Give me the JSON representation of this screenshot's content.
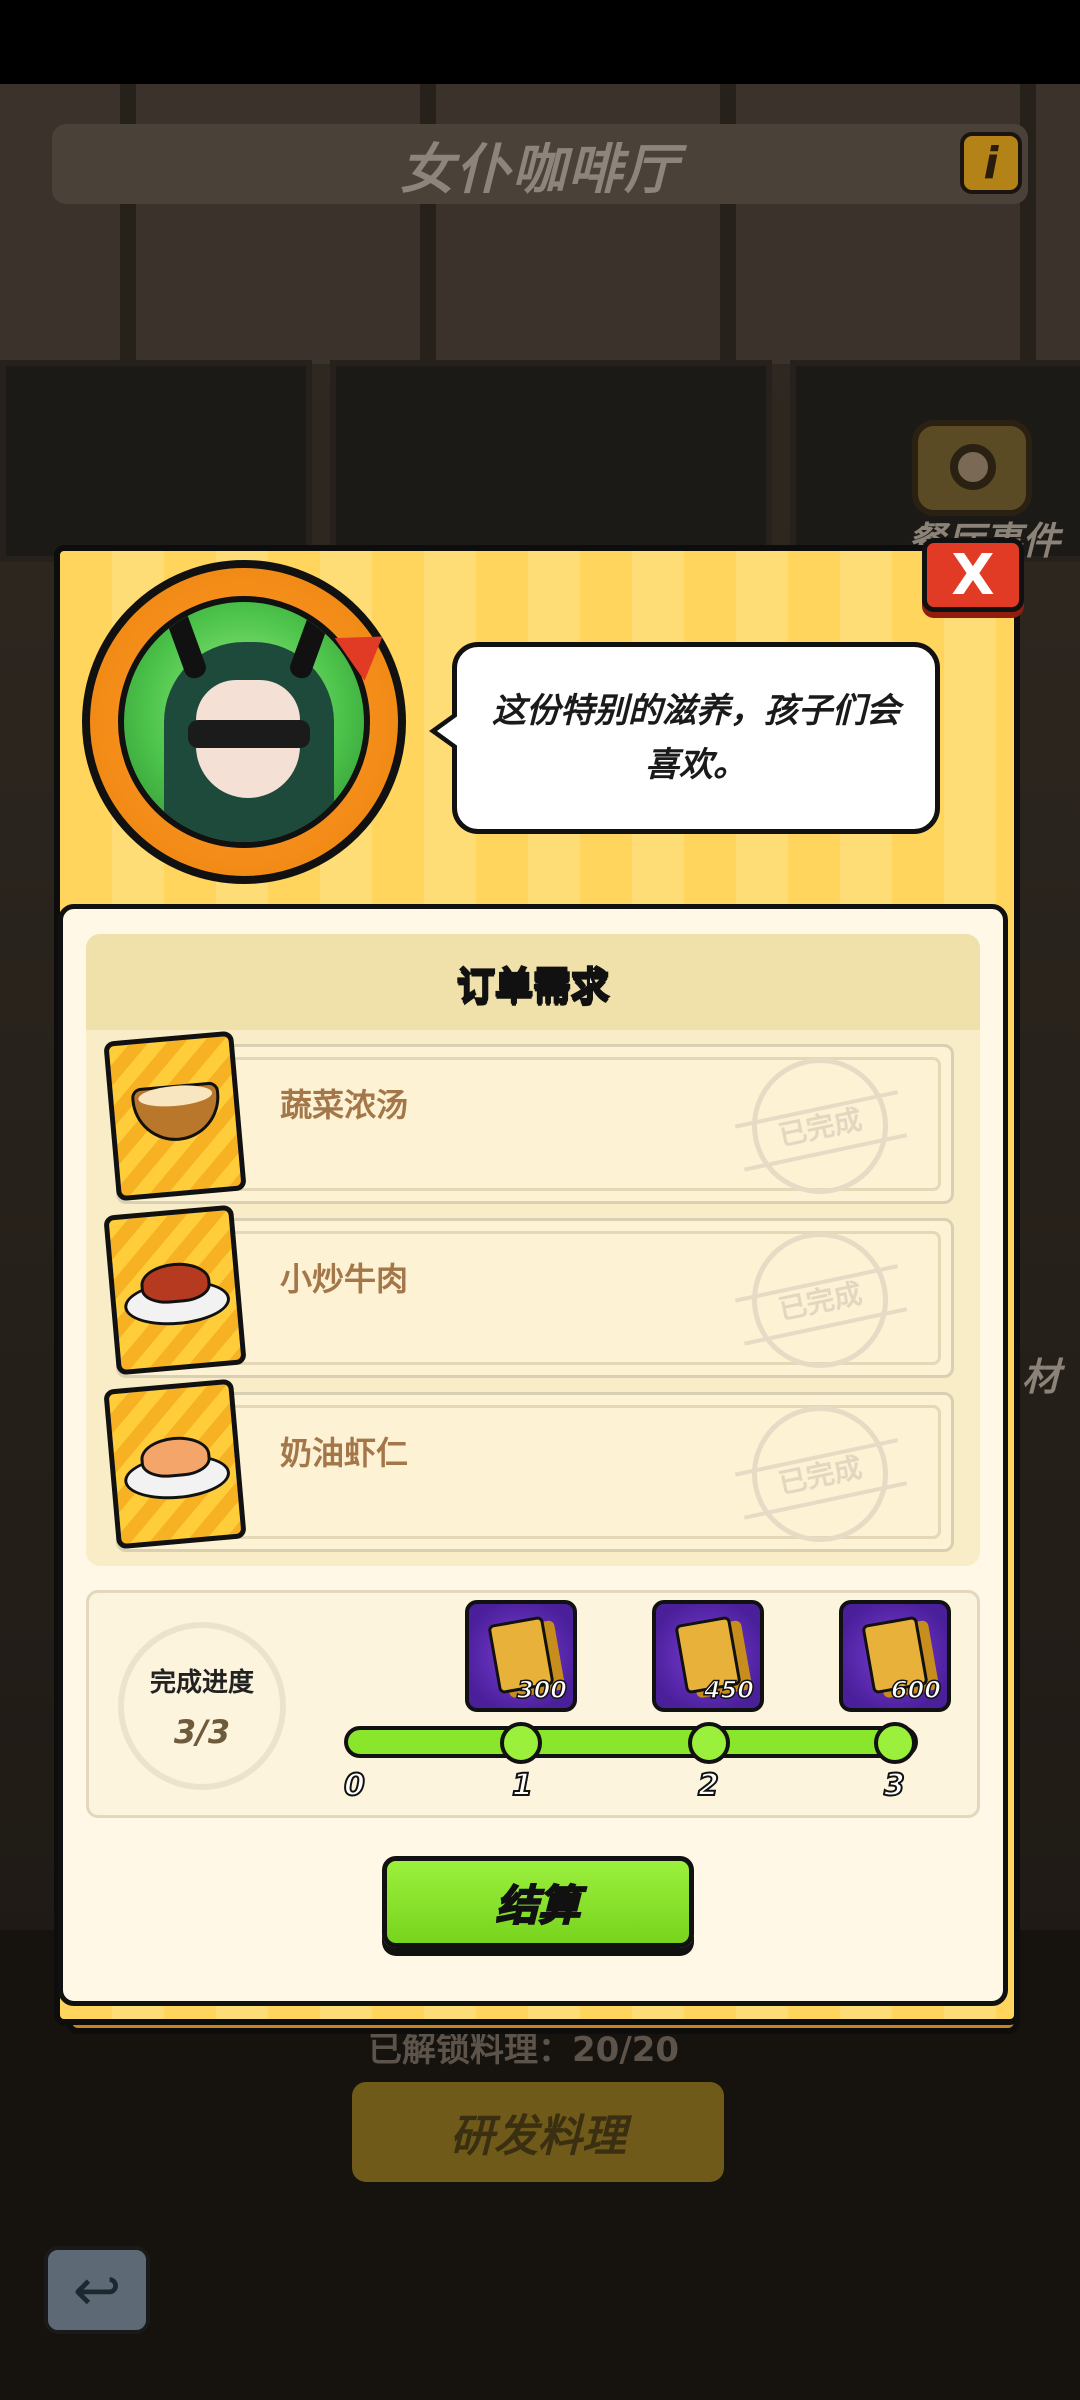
{
  "header": {
    "title": "女仆咖啡厅",
    "info_label": "i"
  },
  "side_menu": {
    "events_label": "餐厅事件",
    "ingredients_label": "材"
  },
  "background": {
    "unlock_text": "已解锁料理：20/20",
    "develop_button": "研发料理"
  },
  "dialog": {
    "close_label": "X",
    "speech": "这份特别的滋养，孩子们会喜欢。",
    "orders_title": "订单需求",
    "orders": [
      {
        "name": "蔬菜浓汤",
        "status": "已完成",
        "dish_icon": "soup-bowl-icon"
      },
      {
        "name": "小炒牛肉",
        "status": "已完成",
        "dish_icon": "stir-fried-beef-icon"
      },
      {
        "name": "奶油虾仁",
        "status": "已完成",
        "dish_icon": "creamy-shrimp-icon"
      }
    ],
    "progress": {
      "title": "完成进度",
      "value": "3/3",
      "completed": 3,
      "total": 3,
      "ticks": [
        "0",
        "1",
        "2",
        "3"
      ],
      "rewards": [
        {
          "threshold": "1",
          "amount": "300"
        },
        {
          "threshold": "2",
          "amount": "450"
        },
        {
          "threshold": "3",
          "amount": "600"
        }
      ]
    },
    "settle_button": "结算"
  },
  "colors": {
    "accent_green": "#8ae62a",
    "close_red": "#e23b25",
    "modal_yellow": "#ffd55e",
    "reward_purple": "#5a2bb0"
  }
}
